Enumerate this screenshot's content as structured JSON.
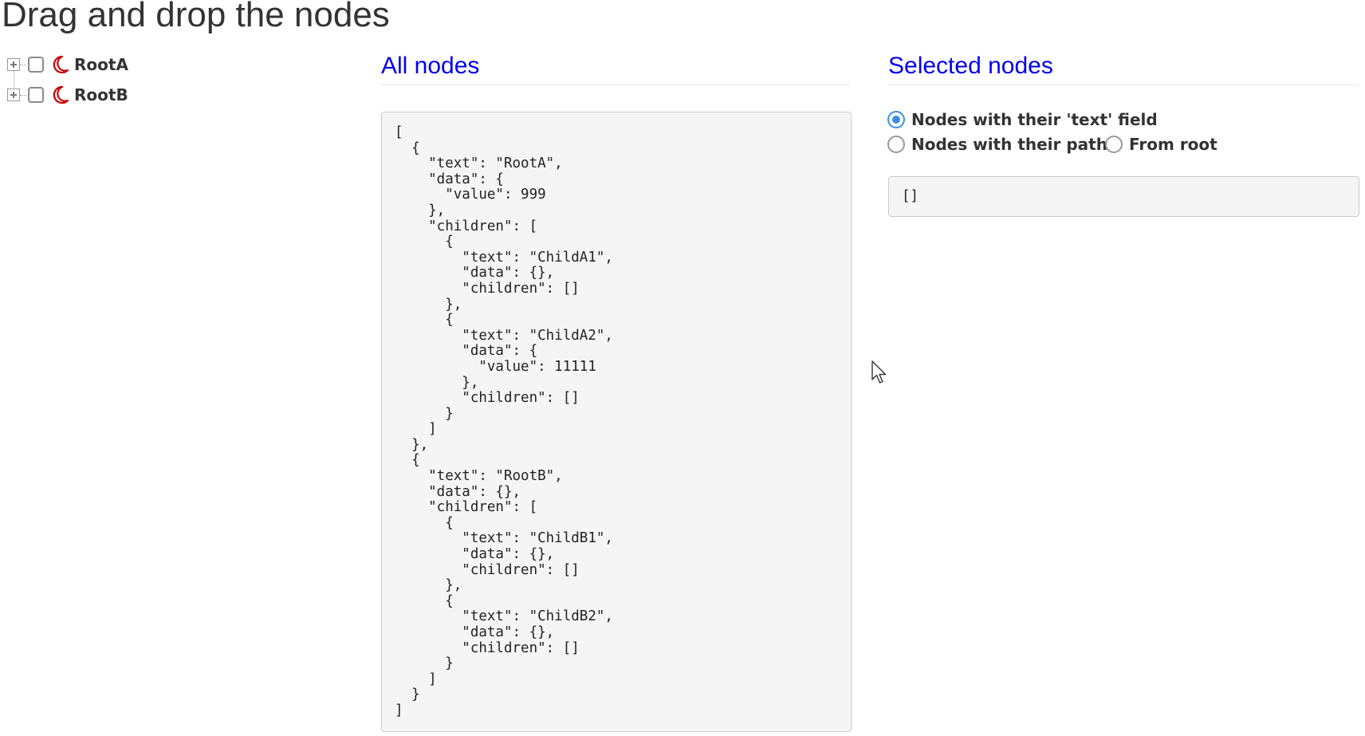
{
  "page": {
    "title": "Drag and drop the nodes"
  },
  "tree": {
    "nodes": [
      {
        "label": "RootA",
        "icon": "moon-icon",
        "checked": false,
        "expanded": false
      },
      {
        "label": "RootB",
        "icon": "moon-icon",
        "checked": false,
        "expanded": false
      }
    ]
  },
  "all_nodes": {
    "heading": "All nodes",
    "json": "[\n  {\n    \"text\": \"RootA\",\n    \"data\": {\n      \"value\": 999\n    },\n    \"children\": [\n      {\n        \"text\": \"ChildA1\",\n        \"data\": {},\n        \"children\": []\n      },\n      {\n        \"text\": \"ChildA2\",\n        \"data\": {\n          \"value\": 11111\n        },\n        \"children\": []\n      }\n    ]\n  },\n  {\n    \"text\": \"RootB\",\n    \"data\": {},\n    \"children\": [\n      {\n        \"text\": \"ChildB1\",\n        \"data\": {},\n        \"children\": []\n      },\n      {\n        \"text\": \"ChildB2\",\n        \"data\": {},\n        \"children\": []\n      }\n    ]\n  }\n]"
  },
  "selected_nodes": {
    "heading": "Selected nodes",
    "options": [
      {
        "label": "Nodes with their 'text' field",
        "checked": true
      },
      {
        "label": "Nodes with their path",
        "checked": false
      },
      {
        "label": "From root",
        "checked": false
      }
    ],
    "json": "[]"
  },
  "colors": {
    "heading_link": "#0000ee",
    "icon_red": "#cc0000",
    "radio_accent": "#3b8ede",
    "code_background": "#f5f5f5"
  }
}
